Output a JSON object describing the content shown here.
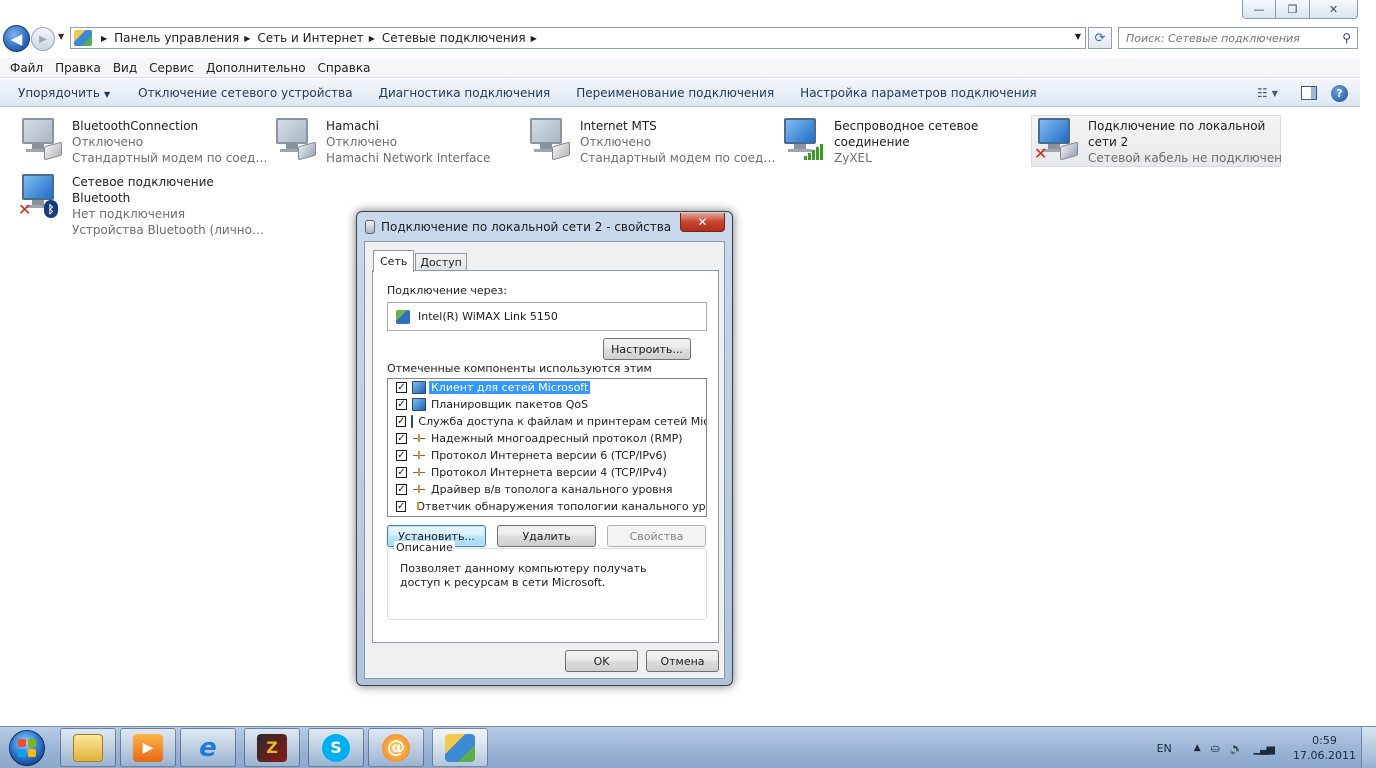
{
  "window": {
    "minimize_label": "—",
    "restore_label": "❐",
    "close_label": "✕"
  },
  "address": {
    "breadcrumbs": [
      "Панель управления",
      "Сеть и Интернет",
      "Сетевые подключения"
    ],
    "search_placeholder": "Поиск: Сетевые подключения"
  },
  "menu": [
    "Файл",
    "Правка",
    "Вид",
    "Сервис",
    "Дополнительно",
    "Справка"
  ],
  "commands": {
    "organize": "Упорядочить",
    "items": [
      "Отключение сетевого устройства",
      "Диагностика подключения",
      "Переименование подключения",
      "Настройка параметров подключения"
    ]
  },
  "connections": [
    {
      "name": "BluetoothConnection",
      "status": "Отключено",
      "device": "Стандартный модем по соедине...",
      "icon": "modem"
    },
    {
      "name": "Hamachi",
      "status": "Отключено",
      "device": "Hamachi Network Interface",
      "icon": "ethernet"
    },
    {
      "name": "Internet MTS",
      "status": "Отключено",
      "device": "Стандартный модем по соедине...",
      "icon": "modem"
    },
    {
      "name": "Беспроводное сетевое соединение",
      "status": "",
      "device": "ZyXEL",
      "icon": "wireless"
    },
    {
      "name": "Подключение по локальной сети 2",
      "status": "Сетевой кабель не подключен",
      "device": "",
      "icon": "ethernet-disconnected"
    },
    {
      "name": "Сетевое подключение Bluetooth",
      "status": "Нет подключения",
      "device": "Устройства Bluetooth (личной с...",
      "icon": "bluetooth"
    }
  ],
  "dialog": {
    "title": "Подключение по локальной сети 2 - свойства",
    "close_label": "✕",
    "tabs": [
      "Сеть",
      "Доступ"
    ],
    "connect_using_label": "Подключение через:",
    "adapter": "Intel(R) WiMAX Link 5150",
    "configure_button": "Настроить...",
    "components_label": "Отмеченные компоненты используются этим подключением:",
    "components": [
      {
        "label": "Клиент для сетей Microsoft",
        "checked": true,
        "icon": "client"
      },
      {
        "label": "Планировщик пакетов QoS",
        "checked": true,
        "icon": "service"
      },
      {
        "label": "Служба доступа к файлам и принтерам сетей Micro...",
        "checked": true,
        "icon": "service"
      },
      {
        "label": "Надежный многоадресный протокол (RMP)",
        "checked": true,
        "icon": "protocol"
      },
      {
        "label": "Протокол Интернета версии 6 (TCP/IPv6)",
        "checked": true,
        "icon": "protocol"
      },
      {
        "label": "Протокол Интернета версии 4 (TCP/IPv4)",
        "checked": true,
        "icon": "protocol"
      },
      {
        "label": "Драйвер в/в тополога канального уровня",
        "checked": true,
        "icon": "protocol"
      },
      {
        "label": "Ответчик обнаружения топологии канального уровня",
        "checked": true,
        "icon": "protocol"
      }
    ],
    "install_button": "Установить...",
    "uninstall_button": "Удалить",
    "properties_button": "Свойства",
    "description_title": "Описание",
    "description_text": "Позволяет данному компьютеру получать доступ к ресурсам в сети Microsoft.",
    "ok_button": "OK",
    "cancel_button": "Отмена"
  },
  "taskbar": {
    "language": "EN",
    "time": "0:59",
    "date": "17.06.2011"
  }
}
